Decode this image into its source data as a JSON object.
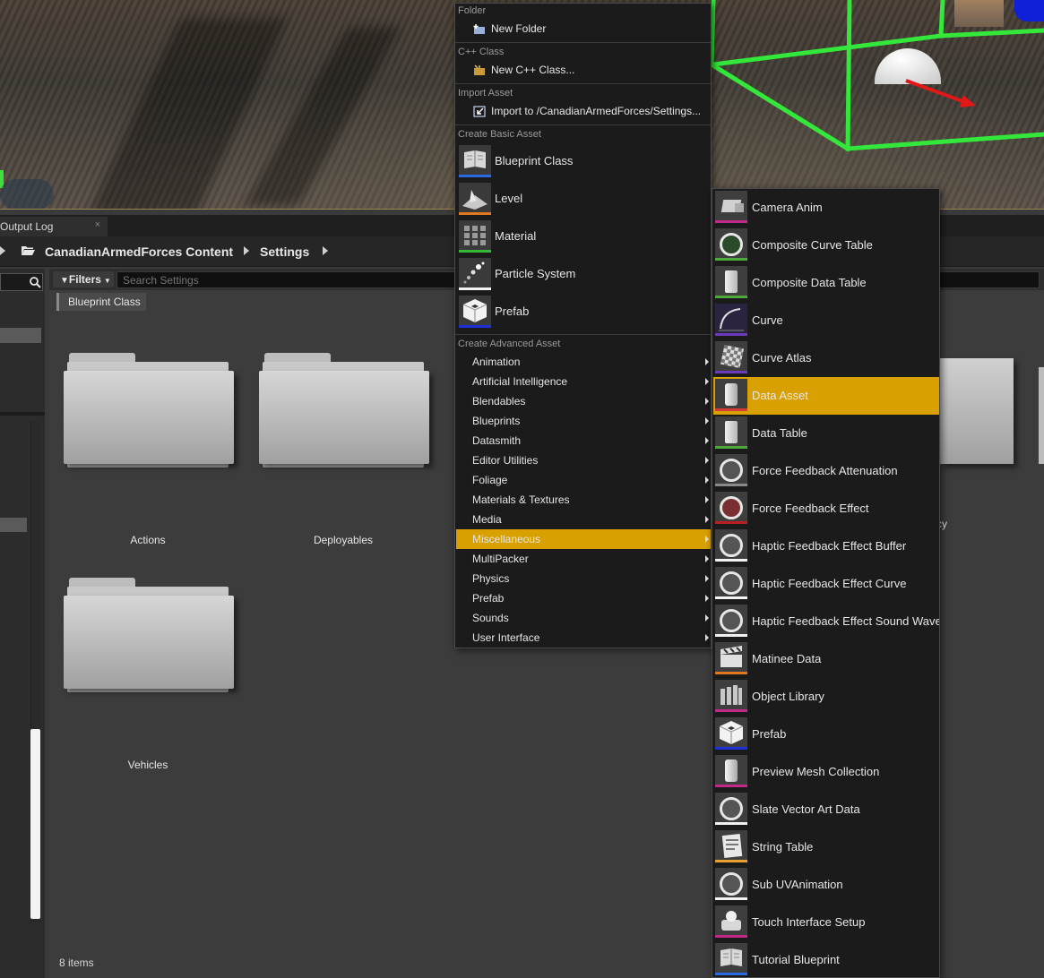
{
  "colors": {
    "highlight": "#d8a000",
    "menu_bg": "#1b1b1b",
    "panel_bg": "#3c3c3c",
    "viewport_green": "#33e83a",
    "arrow_red": "#e01818"
  },
  "output_tab": {
    "label": "Output Log",
    "close": "×"
  },
  "breadcrumb": {
    "root": "CanadianArmedForces Content",
    "current": "Settings"
  },
  "content_browser": {
    "filters_label": "Filters",
    "search_placeholder": "Search Settings",
    "active_filter": "Blueprint Class",
    "folders": [
      "Actions",
      "Deployables",
      "Vehicles"
    ],
    "partial_folder_label": "cy",
    "item_count": "8 items"
  },
  "context_menu": {
    "sections": {
      "folder": "Folder",
      "cpp": "C++ Class",
      "import": "Import Asset",
      "basic": "Create Basic Asset",
      "advanced": "Create Advanced Asset"
    },
    "new_folder": "New Folder",
    "new_cpp": "New C++ Class...",
    "import_to": "Import to /CanadianArmedForces/Settings...",
    "basic_items": [
      {
        "label": "Blueprint Class",
        "icon": "blueprint-icon",
        "bar": "#2a6ae0"
      },
      {
        "label": "Level",
        "icon": "level-icon",
        "bar": "#e07820"
      },
      {
        "label": "Material",
        "icon": "material-icon",
        "bar": "#38b838"
      },
      {
        "label": "Particle System",
        "icon": "particle-icon",
        "bar": "#f2f2f2"
      },
      {
        "label": "Prefab",
        "icon": "prefab-icon",
        "bar": "#2030d8"
      }
    ],
    "advanced_items": [
      "Animation",
      "Artificial Intelligence",
      "Blendables",
      "Blueprints",
      "Datasmith",
      "Editor Utilities",
      "Foliage",
      "Materials & Textures",
      "Media",
      "Miscellaneous",
      "MultiPacker",
      "Physics",
      "Prefab",
      "Sounds",
      "User Interface"
    ],
    "highlighted_advanced": "Miscellaneous"
  },
  "submenu": {
    "highlighted": "Data Asset",
    "items": [
      {
        "label": "Camera Anim",
        "icon": "camera-anim-icon",
        "bar": "#c22a8a"
      },
      {
        "label": "Composite Curve Table",
        "icon": "composite-curve-table-icon",
        "bar": "#4caa3a"
      },
      {
        "label": "Composite Data Table",
        "icon": "composite-data-table-icon",
        "bar": "#4caa3a"
      },
      {
        "label": "Curve",
        "icon": "curve-icon",
        "bar": "#6a3ab8"
      },
      {
        "label": "Curve Atlas",
        "icon": "curve-atlas-icon",
        "bar": "#6a3ab8"
      },
      {
        "label": "Data Asset",
        "icon": "data-asset-icon",
        "bar": "#d83a3a"
      },
      {
        "label": "Data Table",
        "icon": "data-table-icon",
        "bar": "#4caa3a"
      },
      {
        "label": "Force Feedback Attenuation",
        "icon": "force-feedback-attenuation-icon",
        "bar": "#8a8a8a"
      },
      {
        "label": "Force Feedback Effect",
        "icon": "force-feedback-effect-icon",
        "bar": "#b82020"
      },
      {
        "label": "Haptic Feedback Effect Buffer",
        "icon": "haptic-buffer-icon",
        "bar": "#f2f2f2"
      },
      {
        "label": "Haptic Feedback Effect Curve",
        "icon": "haptic-curve-icon",
        "bar": "#f2f2f2"
      },
      {
        "label": "Haptic Feedback Effect Sound Wave",
        "icon": "haptic-sound-wave-icon",
        "bar": "#f2f2f2"
      },
      {
        "label": "Matinee Data",
        "icon": "matinee-data-icon",
        "bar": "#e07820"
      },
      {
        "label": "Object Library",
        "icon": "object-library-icon",
        "bar": "#c22a8a"
      },
      {
        "label": "Prefab",
        "icon": "prefab-icon",
        "bar": "#2030d8"
      },
      {
        "label": "Preview Mesh Collection",
        "icon": "preview-mesh-collection-icon",
        "bar": "#c22a8a"
      },
      {
        "label": "Slate Vector Art Data",
        "icon": "slate-vector-art-icon",
        "bar": "#f2f2f2"
      },
      {
        "label": "String Table",
        "icon": "string-table-icon",
        "bar": "#e8a030"
      },
      {
        "label": "Sub UVAnimation",
        "icon": "sub-uv-animation-icon",
        "bar": "#f2f2f2"
      },
      {
        "label": "Touch Interface Setup",
        "icon": "touch-interface-icon",
        "bar": "#c22a8a"
      },
      {
        "label": "Tutorial Blueprint",
        "icon": "tutorial-blueprint-icon",
        "bar": "#2a6ae0"
      }
    ]
  }
}
